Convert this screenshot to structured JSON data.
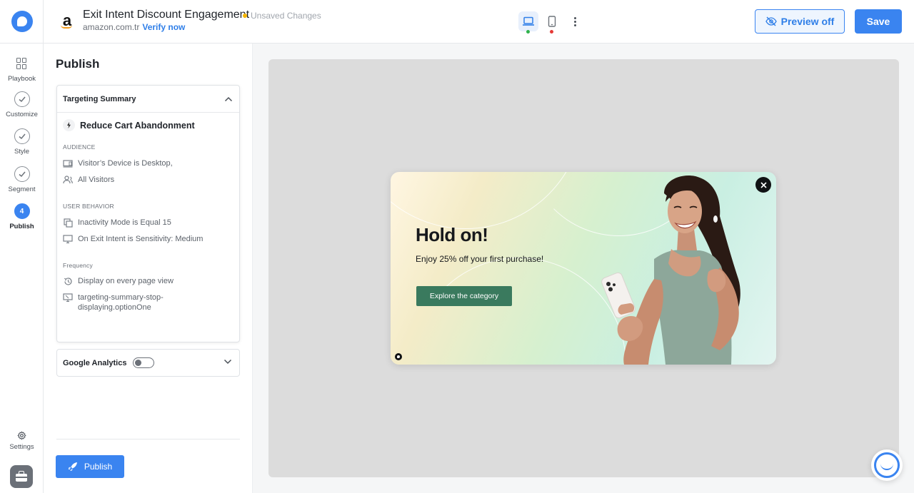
{
  "colors": {
    "accent": "#3a84f0",
    "cta_green": "#3a7a5e",
    "desktop_status": "#2fb24c",
    "mobile_status": "#e53935",
    "unsaved_dot": "#f5b400"
  },
  "rail": {
    "logo_icon": "app-logo-icon",
    "steps": [
      {
        "label": "Playbook",
        "icon": "grid-icon",
        "state": "default"
      },
      {
        "label": "Customize",
        "icon": "check-circle-icon",
        "state": "done"
      },
      {
        "label": "Style",
        "icon": "check-circle-icon",
        "state": "done"
      },
      {
        "label": "Segment",
        "icon": "check-circle-icon",
        "state": "done"
      },
      {
        "label": "Publish",
        "number": "4",
        "state": "active"
      }
    ],
    "settings_label": "Settings"
  },
  "header": {
    "title": "Exit Intent Discount Engagement",
    "status": "Unsaved Changes",
    "domain": "amazon.com.tr",
    "verify_link": "Verify now",
    "preview_button": "Preview off",
    "save_button": "Save"
  },
  "panel": {
    "title": "Publish",
    "targeting": {
      "heading": "Targeting Summary",
      "goal": "Reduce Cart Abandonment",
      "audience_label": "AUDIENCE",
      "audience": [
        {
          "icon": "desktop-icon",
          "text": "Visitor’s Device is Desktop,"
        },
        {
          "icon": "users-icon",
          "text": "All Visitors"
        }
      ],
      "behavior_label": "USER BEHAVIOR",
      "behavior": [
        {
          "icon": "copy-icon",
          "text": "Inactivity Mode is Equal 15"
        },
        {
          "icon": "monitor-icon",
          "text": "On Exit Intent is Sensitivity: Medium"
        }
      ],
      "frequency_label": "Frequency",
      "frequency": [
        {
          "icon": "history-icon",
          "text": "Display on every page view"
        },
        {
          "icon": "monitor-stop-icon",
          "text": "targeting-summary-stop-displaying.optionOne"
        }
      ]
    },
    "analytics": {
      "label": "Google Analytics",
      "enabled": false
    },
    "publish_button": "Publish"
  },
  "popup": {
    "heading": "Hold on!",
    "subheading": "Enjoy 25% off your first purchase!",
    "cta": "Explore the category"
  }
}
